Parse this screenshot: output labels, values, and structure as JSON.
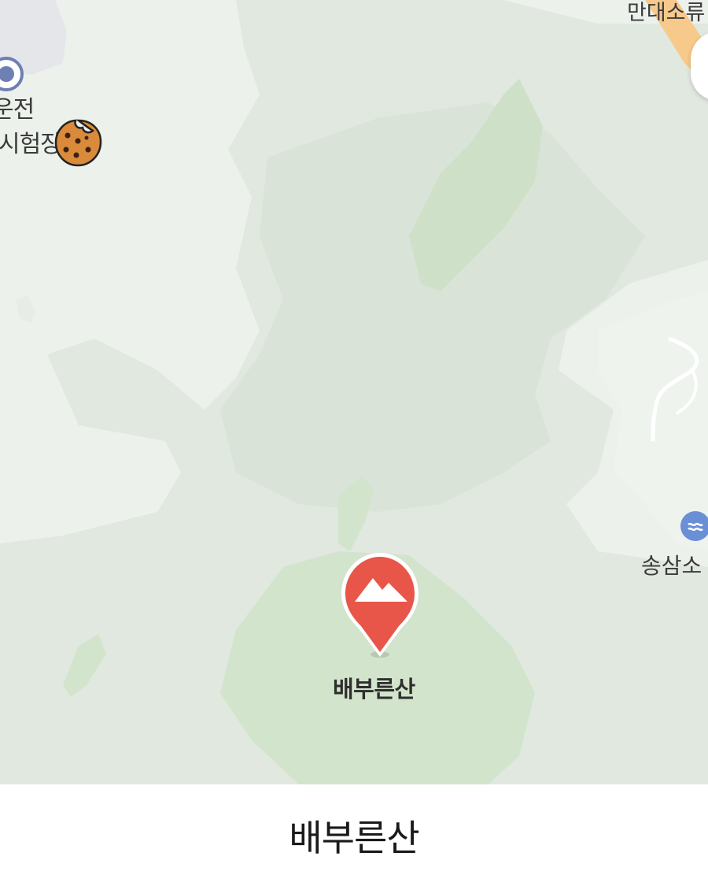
{
  "map": {
    "labels": {
      "top_right": "만대소류",
      "test_center_line1": "운전",
      "test_center_line2": "시험장",
      "reservoir": "송삼소",
      "peak": "배부른산"
    },
    "icons": {
      "target_poi": "target-icon",
      "cookie": "cookie-icon",
      "water_poi": "water-icon",
      "mountain_pin": "mountain-pin-icon"
    },
    "colors": {
      "land": "#edf1ec",
      "forest_light": "#e2e9e1",
      "forest": "#d9e3d7",
      "peak_area": "#d2e4cc",
      "pin": "#e8564a",
      "water_poi": "#6a8fd6",
      "target_poi": "#6d7fb3",
      "road_orange": "#f7c98a"
    }
  },
  "caption": {
    "text": "배부른산"
  }
}
